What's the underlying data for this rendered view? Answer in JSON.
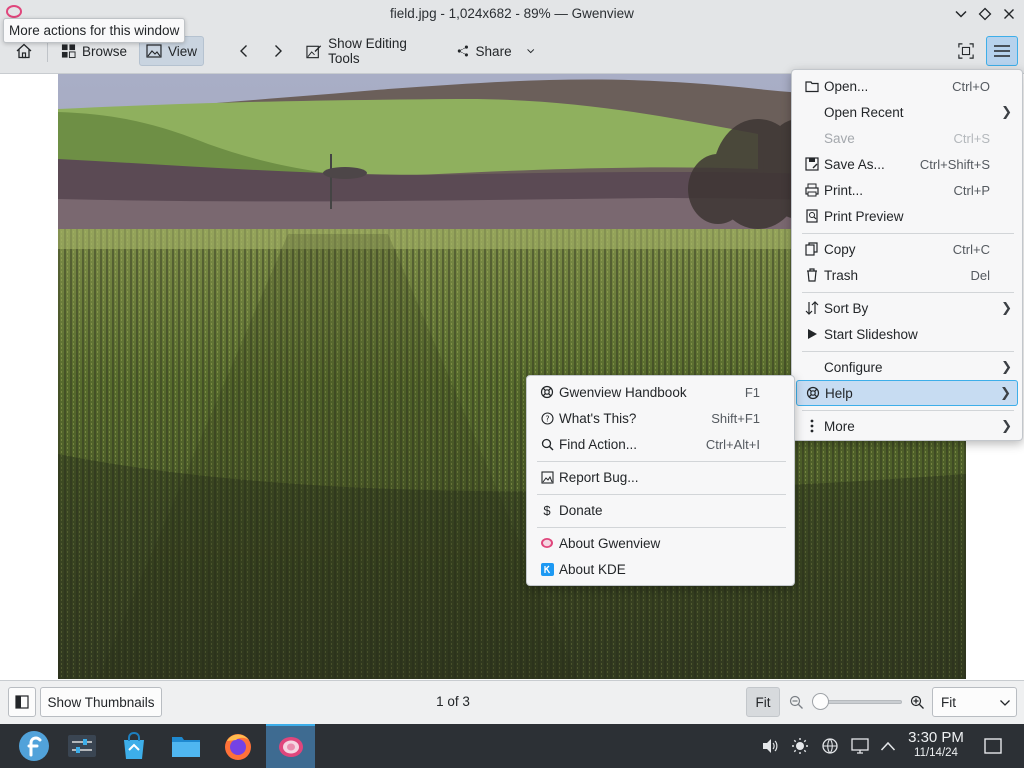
{
  "window": {
    "title": "field.jpg - 1,024x682 - 89% — Gwenview",
    "tooltip": "More actions for this window"
  },
  "toolbar": {
    "browse_label": "Browse",
    "view_label": "View",
    "editing_label": "Show Editing Tools",
    "share_label": "Share"
  },
  "main_menu": {
    "items": [
      {
        "label": "Open...",
        "shortcut": "Ctrl+O"
      },
      {
        "label": "Open Recent",
        "shortcut": ""
      },
      {
        "label": "Save",
        "shortcut": "Ctrl+S"
      },
      {
        "label": "Save As...",
        "shortcut": "Ctrl+Shift+S"
      },
      {
        "label": "Print...",
        "shortcut": "Ctrl+P"
      },
      {
        "label": "Print Preview",
        "shortcut": ""
      },
      {
        "label": "Copy",
        "shortcut": "Ctrl+C"
      },
      {
        "label": "Trash",
        "shortcut": "Del"
      },
      {
        "label": "Sort By",
        "shortcut": ""
      },
      {
        "label": "Start Slideshow",
        "shortcut": ""
      },
      {
        "label": "Configure",
        "shortcut": ""
      },
      {
        "label": "Help",
        "shortcut": ""
      },
      {
        "label": "More",
        "shortcut": ""
      }
    ]
  },
  "help_menu": {
    "items": [
      {
        "label": "Gwenview Handbook",
        "shortcut": "F1"
      },
      {
        "label": "What's This?",
        "shortcut": "Shift+F1"
      },
      {
        "label": "Find Action...",
        "shortcut": "Ctrl+Alt+I"
      },
      {
        "label": "Report Bug...",
        "shortcut": ""
      },
      {
        "label": "Donate",
        "shortcut": ""
      },
      {
        "label": "About Gwenview",
        "shortcut": ""
      },
      {
        "label": "About KDE",
        "shortcut": ""
      }
    ]
  },
  "statusbar": {
    "thumbnails_label": "Show Thumbnails",
    "position": "1 of 3",
    "fit_button": "Fit",
    "zoom_select": "Fit",
    "zoom_level": 0
  },
  "clock": {
    "time": "3:30 PM",
    "date": "11/14/24"
  },
  "colors": {
    "accent": "#3daee9",
    "highlight": "#c7dcf2",
    "taskbar": "#2c3035",
    "gwenview": "#e0467c"
  }
}
